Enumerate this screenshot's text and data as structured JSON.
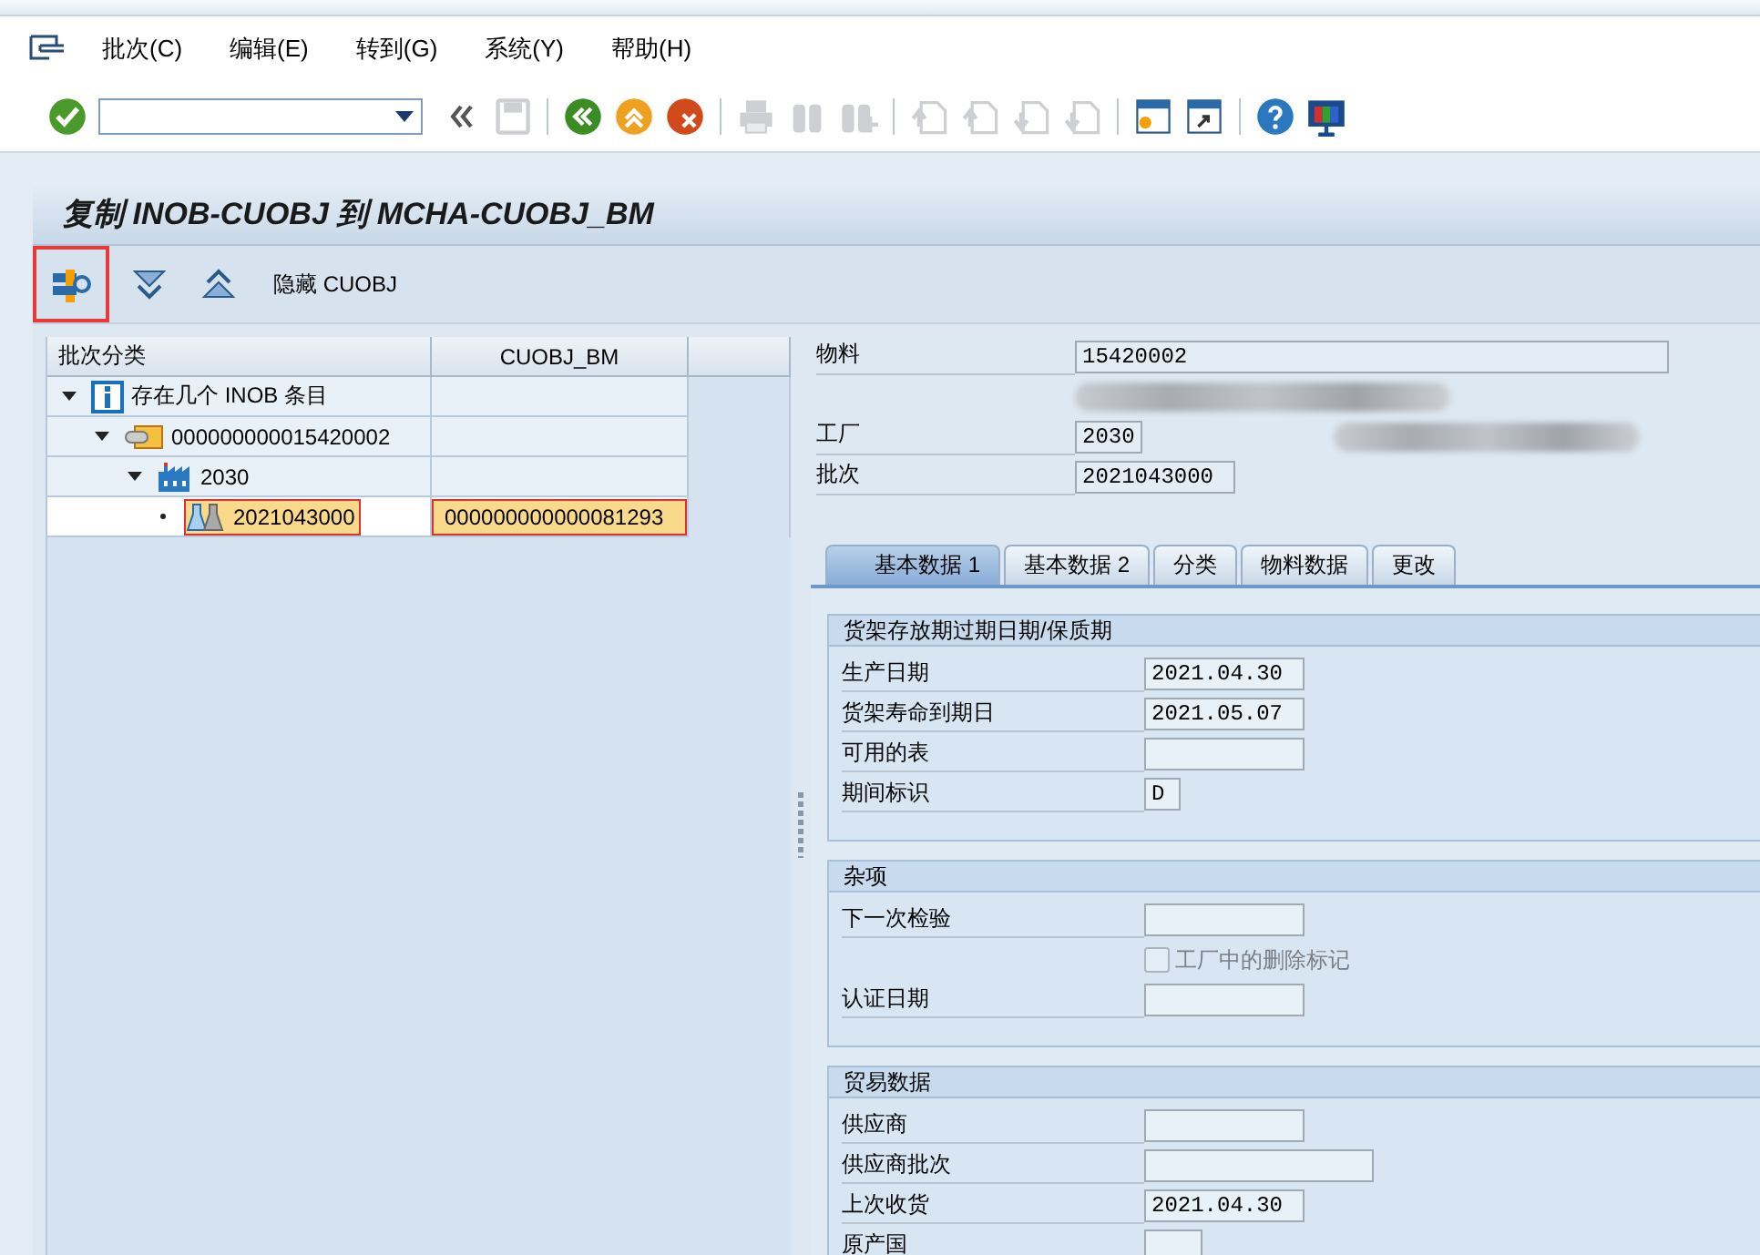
{
  "menu": [
    {
      "label": "批次(C)"
    },
    {
      "label": "编辑(E)"
    },
    {
      "label": "转到(G)"
    },
    {
      "label": "系统(Y)"
    },
    {
      "label": "帮助(H)"
    }
  ],
  "toolbar": [
    {
      "kind": "enter",
      "disabled": false
    },
    {
      "kind": "command-field"
    },
    {
      "kind": "collapse",
      "disabled": false
    },
    {
      "kind": "save",
      "disabled": true
    },
    {
      "kind": "sep"
    },
    {
      "kind": "back",
      "disabled": false
    },
    {
      "kind": "exit",
      "disabled": false
    },
    {
      "kind": "cancel",
      "disabled": false
    },
    {
      "kind": "sep"
    },
    {
      "kind": "print",
      "disabled": true
    },
    {
      "kind": "find",
      "disabled": true
    },
    {
      "kind": "find-next",
      "disabled": true
    },
    {
      "kind": "sep"
    },
    {
      "kind": "first-page",
      "disabled": true
    },
    {
      "kind": "prev-page",
      "disabled": true
    },
    {
      "kind": "next-page",
      "disabled": true
    },
    {
      "kind": "last-page",
      "disabled": true
    },
    {
      "kind": "sep"
    },
    {
      "kind": "new-session",
      "disabled": false
    },
    {
      "kind": "shortcut",
      "disabled": false
    },
    {
      "kind": "sep"
    },
    {
      "kind": "help",
      "disabled": false
    },
    {
      "kind": "layout",
      "disabled": false
    }
  ],
  "title": "复制 INOB-CUOBJ 到 MCHA-CUOBJ_BM",
  "app_toolbar": [
    {
      "kind": "tools",
      "selected": true
    },
    {
      "kind": "expand",
      "selected": false
    },
    {
      "kind": "collapse-all",
      "selected": false
    },
    {
      "kind": "text",
      "label": "隐藏 CUOBJ",
      "selected": false
    }
  ],
  "tree": {
    "columns": [
      "批次分类",
      "CUOBJ_BM"
    ],
    "nodes": [
      {
        "kind": "info",
        "label": "存在几个 INOB 条目",
        "expanded": true,
        "selected": false,
        "children": [
          {
            "kind": "material",
            "label": "000000000015420002",
            "expanded": true,
            "selected": false,
            "children": [
              {
                "kind": "plant",
                "label": "2030",
                "expanded": true,
                "selected": false,
                "children": [
                  {
                    "kind": "batch",
                    "label": "2021043000",
                    "cuobj_bm": "000000000000081293",
                    "selected": true
                  }
                ]
              }
            ]
          }
        ]
      }
    ]
  },
  "header": {
    "fields": [
      {
        "kind": "wide-field",
        "label": "物料",
        "value": "15420002"
      },
      {
        "kind": "redacted"
      },
      {
        "kind": "short-field",
        "label": "工厂",
        "value": "2030",
        "redacted_after": true
      },
      {
        "kind": "field",
        "label": "批次",
        "value": "2021043000"
      }
    ]
  },
  "tabs": [
    {
      "label": "基本数据 1",
      "selected": true
    },
    {
      "label": "基本数据 2",
      "selected": false
    },
    {
      "label": "分类",
      "selected": false
    },
    {
      "label": "物料数据",
      "selected": false
    },
    {
      "label": "更改",
      "selected": false
    }
  ],
  "groups": [
    {
      "title": "货架存放期过期日期/保质期",
      "rows": [
        {
          "kind": "field",
          "label": "生产日期",
          "value": "2021.04.30"
        },
        {
          "kind": "field",
          "label": "货架寿命到期日",
          "value": "2021.05.07"
        },
        {
          "kind": "field",
          "label": "可用的表"
        },
        {
          "kind": "char-field",
          "label": "期间标识",
          "value": "D"
        }
      ]
    },
    {
      "title": "杂项",
      "rows": [
        {
          "kind": "field",
          "label": "下一次检验"
        },
        {
          "kind": "checkbox",
          "label": "工厂中的删除标记",
          "checked": false,
          "disabled": true
        },
        {
          "kind": "field",
          "label": "认证日期"
        }
      ]
    },
    {
      "title": "贸易数据",
      "rows": [
        {
          "kind": "field",
          "label": "供应商"
        },
        {
          "kind": "long-field",
          "label": "供应商批次"
        },
        {
          "kind": "field",
          "label": "上次收货",
          "value": "2021.04.30"
        },
        {
          "kind": "short-field",
          "label": "原产国"
        }
      ]
    }
  ]
}
